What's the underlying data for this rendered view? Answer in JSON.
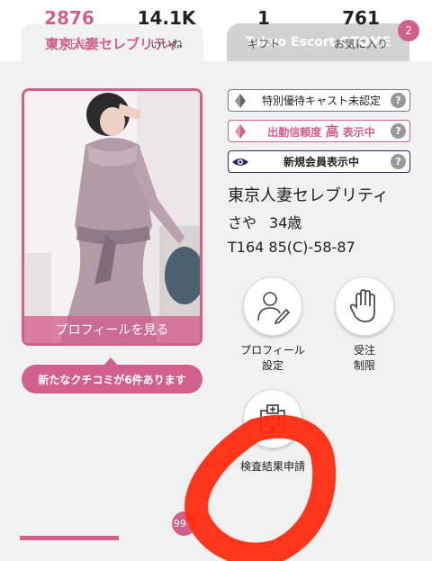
{
  "tabs": [
    {
      "label": "東京人妻セレブリティ"
    },
    {
      "label": "Tokyo Escort OTOME",
      "badge": "2"
    }
  ],
  "profile": {
    "photo_cta": "プロフィールを見る",
    "review_notice": "新たなクチコミが6件あります"
  },
  "status_rows": [
    {
      "label": "特別優待キャスト未認定",
      "help": "?"
    },
    {
      "label_prefix": "出勤信頼度",
      "label_strong": "高",
      "label_suffix": "表示中",
      "help": "?"
    },
    {
      "label": "新規会員表示中",
      "help": "?"
    }
  ],
  "cast": {
    "shop_name": "東京人妻セレブリティ",
    "name": "さや",
    "age": "34歳",
    "measurements": "T164 85(C)-58-87"
  },
  "actions": [
    {
      "label_line1": "プロフィール",
      "label_line2": "設定"
    },
    {
      "label_line1": "受注",
      "label_line2": "制限"
    },
    {
      "label_line1": "検査結果申請"
    }
  ],
  "stats": [
    {
      "value": "2876",
      "label": "写メ日記"
    },
    {
      "value": "14.1K",
      "label": "いいね",
      "badge": "99+"
    },
    {
      "value": "1",
      "label": "ギフト"
    },
    {
      "value": "761",
      "label": "お気に入り"
    }
  ],
  "colors": {
    "accent": "#d25f8c",
    "annotation": "#ff2a10"
  }
}
